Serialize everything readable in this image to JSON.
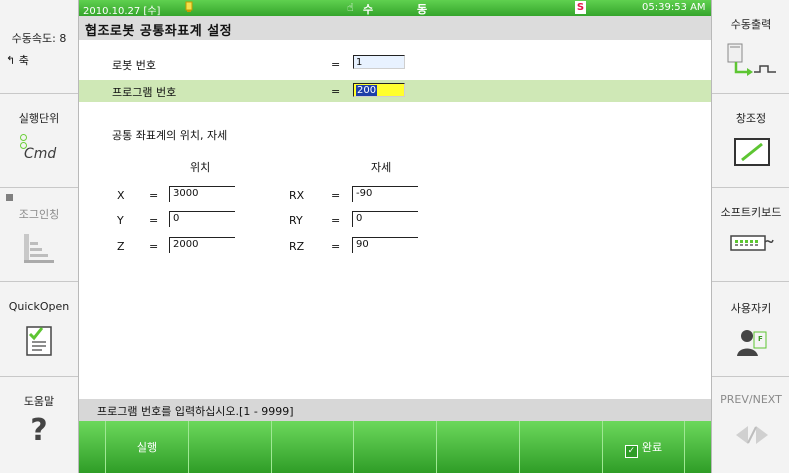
{
  "top_bar": {
    "date": "2010.10.27 [수]",
    "mode_label": "수 동",
    "mode_chars": [
      "수",
      "동"
    ],
    "s_badge": "S",
    "time": "05:39:53 AM"
  },
  "left_panel": {
    "speed": "수동속도: 8",
    "axis": "축",
    "exec_unit": "실행단위",
    "cmd_icon_text": "Cmd",
    "jog_inching": "조그인칭",
    "quickopen": "QuickOpen",
    "help": "도움말",
    "help_glyph": "?"
  },
  "right_panel": {
    "manual_output": "수동출력",
    "window_adjust": "창조정",
    "soft_keyboard": "소프트키보드",
    "user_key": "사용자키",
    "user_key_badge": "F",
    "prev_next": "PREV/NEXT"
  },
  "title": "협조로봇 공통좌표계 설정",
  "form": {
    "robot_no_label": "로봇 번호",
    "robot_no_eq": "=",
    "robot_no_value": "1",
    "program_no_label": "프로그램 번호",
    "program_no_eq": "=",
    "program_no_value": "200",
    "section_label": "공통 좌표계의 위치, 자세",
    "pos_header": "위치",
    "pose_header": "자세",
    "eq": "=",
    "x_label": "X",
    "x_value": "3000",
    "y_label": "Y",
    "y_value": "0",
    "z_label": "Z",
    "z_value": "2000",
    "rx_label": "RX",
    "rx_value": "-90",
    "ry_label": "RY",
    "ry_value": "0",
    "rz_label": "RZ",
    "rz_value": "90"
  },
  "status_message": "프로그램 번호를 입력하십시오.[1 - 9999]",
  "function_keys": {
    "f1": "실행",
    "f7": "완료"
  },
  "colors": {
    "green_bar": "#35a52c",
    "highlight_row": "#cfe8b6",
    "input_yellow": "#ffff2e"
  }
}
